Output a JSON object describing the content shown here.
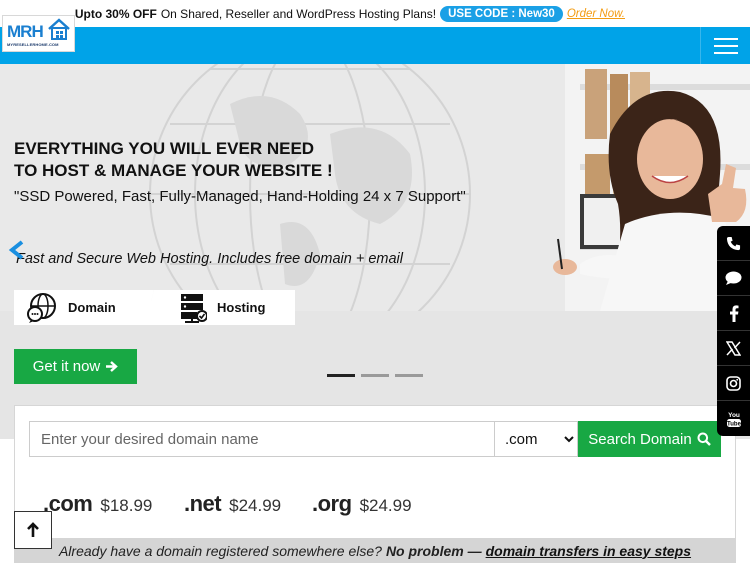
{
  "promo": {
    "lead": "Upto 30% OFF",
    "text": "On Shared, Reseller and WordPress Hosting Plans!",
    "code": "USE CODE : New30",
    "order": "Order Now."
  },
  "logo": {
    "text": "MRH",
    "subtext": "MYRESELLERHOME.COM"
  },
  "hero": {
    "headline1": "EVERYTHING YOU WILL EVER NEED",
    "headline2": "TO HOST & MANAGE YOUR WEBSITE !",
    "tagline": "\"SSD Powered, Fast, Fully-Managed, Hand-Holding 24 x 7 Support\"",
    "subtag": "Fast and Secure Web Hosting. Includes free domain + email",
    "tabs": [
      {
        "label": "Domain",
        "icon": "globe-chat-icon"
      },
      {
        "label": "Hosting",
        "icon": "server-icon"
      }
    ],
    "cta": "Get it now",
    "slides": {
      "count": 3,
      "active": 1
    }
  },
  "social": [
    "phone-icon",
    "chat-icon",
    "facebook-icon",
    "x-icon",
    "instagram-icon",
    "youtube-icon"
  ],
  "search": {
    "placeholder": "Enter your desired domain name",
    "tld": ".com",
    "button": "Search Domain"
  },
  "prices": [
    {
      "ext": ".com",
      "amount": "$18.99"
    },
    {
      "ext": ".net",
      "amount": "$24.99"
    },
    {
      "ext": ".org",
      "amount": "$24.99"
    }
  ],
  "transfer": {
    "text": "Already have a domain registered somewhere else?",
    "no_problem": "No problem —",
    "link": "domain transfers in easy steps"
  },
  "colors": {
    "brand_blue": "#00a3e8",
    "green": "#18a844",
    "code_blue": "#1aa0e6",
    "order_orange": "#f39c12"
  }
}
